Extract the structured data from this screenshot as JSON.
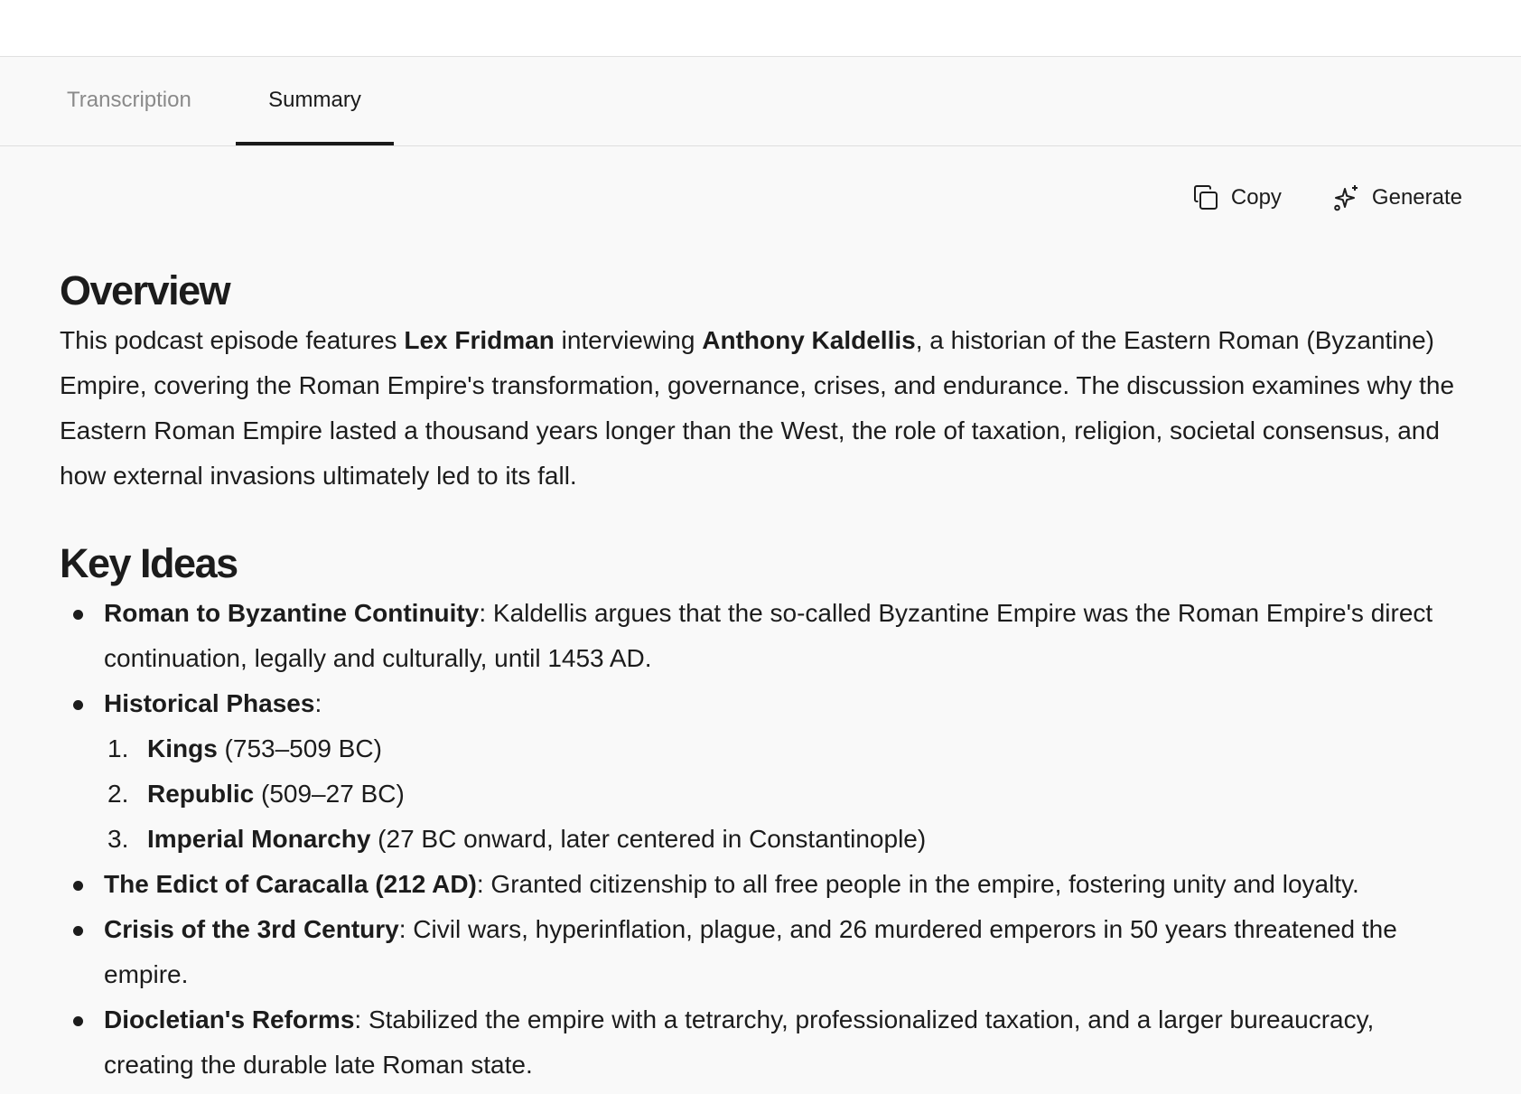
{
  "tabs": {
    "transcription": "Transcription",
    "summary": "Summary"
  },
  "toolbar": {
    "copy_label": "Copy",
    "generate_label": "Generate",
    "copy_icon": "copy-icon",
    "generate_icon": "sparkle-icon"
  },
  "overview": {
    "heading": "Overview",
    "text_1": "This podcast episode features ",
    "bold_1": "Lex Fridman",
    "text_2": " interviewing ",
    "bold_2": "Anthony Kaldellis",
    "text_3": ", a historian of the Eastern Roman (Byzantine) Empire, covering the Roman Empire's transformation, governance, crises, and endurance. The discussion examines why the Eastern Roman Empire lasted a thousand years longer than the West, the role of taxation, religion, societal consensus, and how external invasions ultimately led to its fall."
  },
  "key_ideas": {
    "heading": "Key Ideas",
    "items": [
      {
        "title": "Roman to Byzantine Continuity",
        "text": ": Kaldellis argues that the so-called Byzantine Empire was the Roman Empire's direct continuation, legally and culturally, until 1453 AD."
      },
      {
        "title": "Historical Phases",
        "text": ":",
        "phases": [
          {
            "num": "1.",
            "title": "Kings",
            "text": " (753–509 BC)"
          },
          {
            "num": "2.",
            "title": "Republic",
            "text": " (509–27 BC)"
          },
          {
            "num": "3.",
            "title": "Imperial Monarchy",
            "text": " (27 BC onward, later centered in Constantinople)"
          }
        ]
      },
      {
        "title": "The Edict of Caracalla (212 AD)",
        "text": ": Granted citizenship to all free people in the empire, fostering unity and loyalty."
      },
      {
        "title": "Crisis of the 3rd Century",
        "text": ": Civil wars, hyperinflation, plague, and 26 murdered emperors in 50 years threatened the empire."
      },
      {
        "title": "Diocletian's Reforms",
        "text": ": Stabilized the empire with a tetrarchy, professionalized taxation, and a larger bureaucracy, creating the durable late Roman state."
      }
    ]
  }
}
